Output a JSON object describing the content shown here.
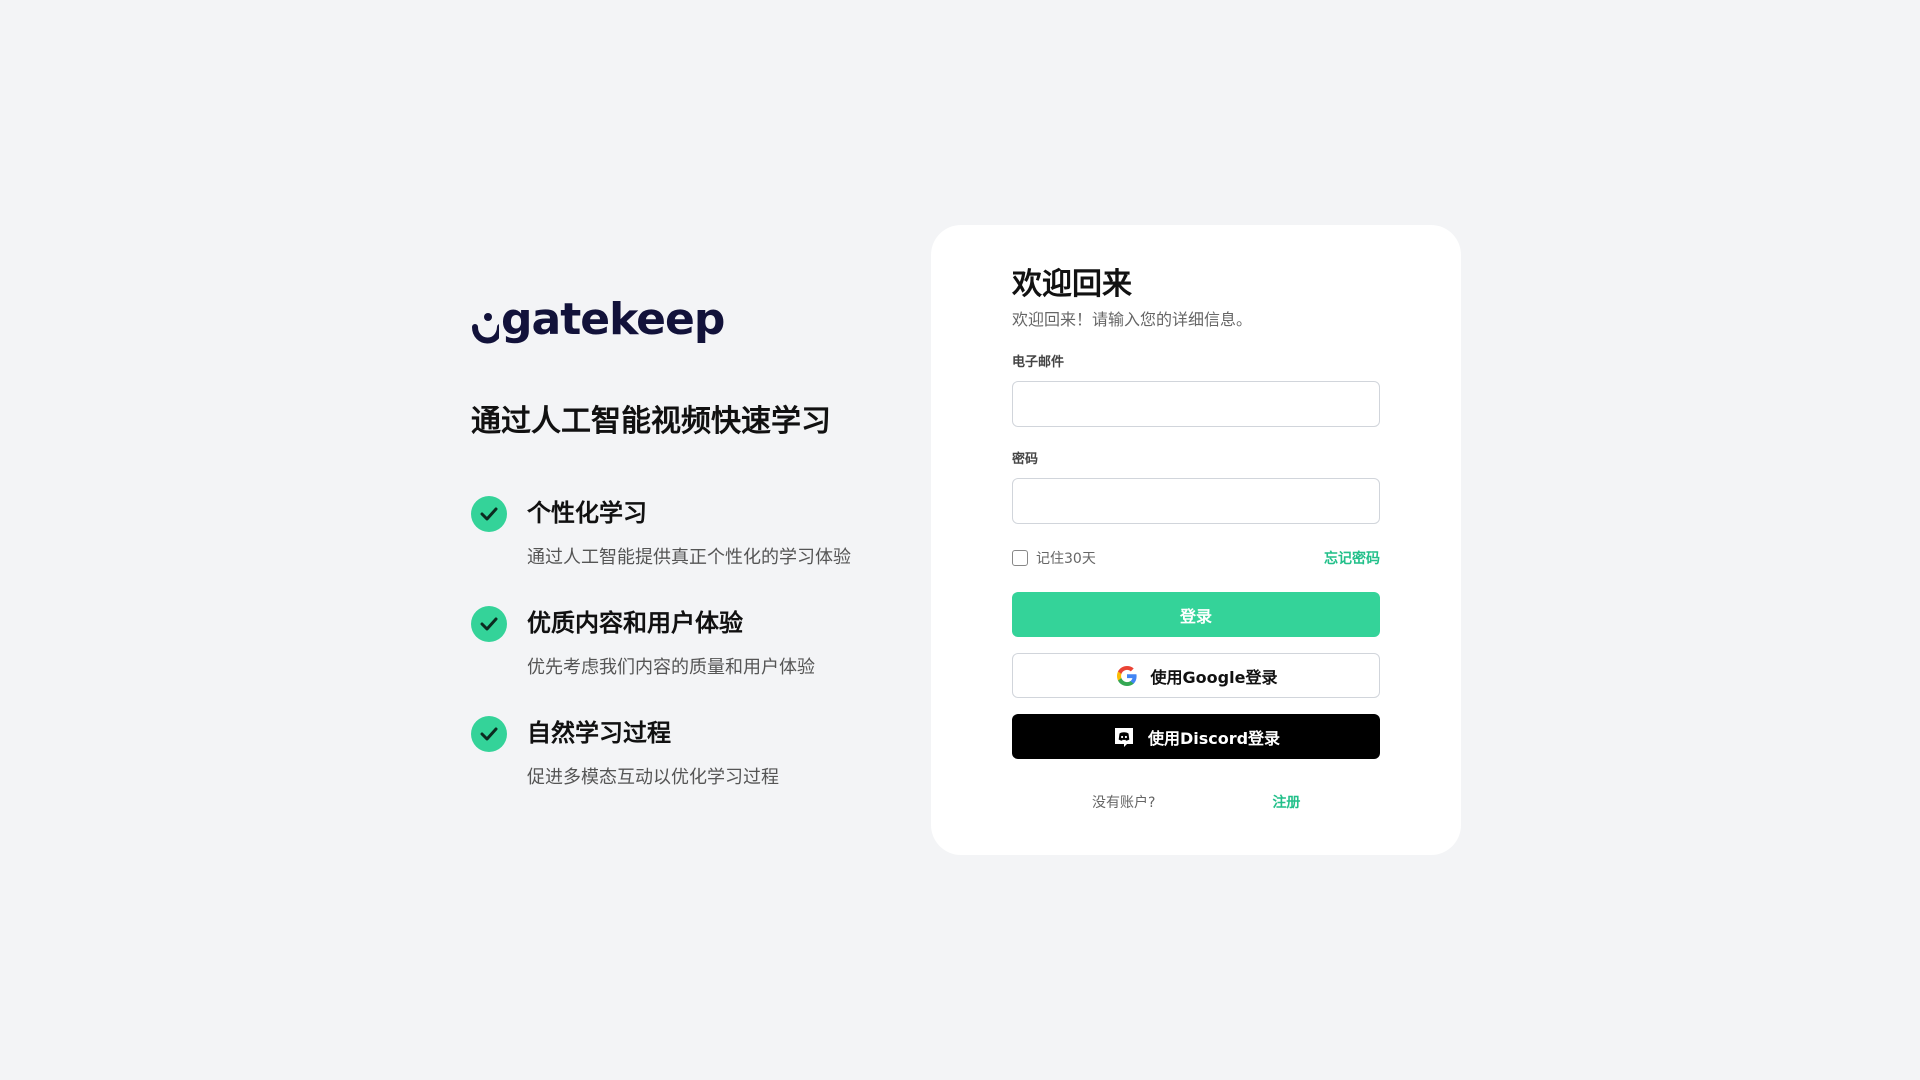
{
  "brand": {
    "name": "gatekeep",
    "tagline": "通过人工智能视频快速学习",
    "color": "#12123a"
  },
  "features": [
    {
      "title": "个性化学习",
      "description": "通过人工智能提供真正个性化的学习体验"
    },
    {
      "title": "优质内容和用户体验",
      "description": "优先考虑我们内容的质量和用户体验"
    },
    {
      "title": "自然学习过程",
      "description": "促进多模态互动以优化学习过程"
    }
  ],
  "login": {
    "title": "欢迎回来",
    "subtitle": "欢迎回来！请输入您的详细信息。",
    "email_label": "电子邮件",
    "email_value": "",
    "password_label": "密码",
    "password_value": "",
    "remember_label": "记住30天",
    "remember_checked": false,
    "forgot_label": "忘记密码",
    "submit_label": "登录",
    "google_label": "使用Google登录",
    "discord_label": "使用Discord登录",
    "no_account_text": "没有账户?",
    "signup_label": "注册"
  },
  "icons": {
    "feature_check": "check-circle-icon",
    "google": "google-icon",
    "discord": "discord-icon"
  },
  "colors": {
    "accent": "#34d399",
    "link": "#22c08a",
    "page_bg": "#f3f4f6",
    "discord_button_bg": "#000000"
  }
}
